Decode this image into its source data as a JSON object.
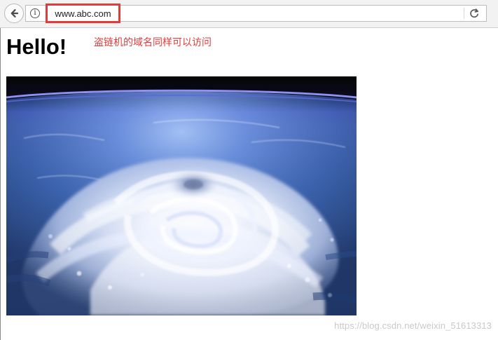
{
  "browser": {
    "url": "www.abc.com",
    "url_highlight_color": "#e53a3a",
    "back_icon": "back-arrow-icon",
    "info_icon": "info-icon",
    "info_glyph": "i",
    "reload_icon": "reload-icon"
  },
  "page": {
    "heading": "Hello!",
    "annotation": "盗链机的域名同样可以访问",
    "image_description": "hurricane-satellite-photo"
  },
  "watermark": {
    "text": "https://blog.csdn.net/weixin_51613313"
  },
  "colors": {
    "annotation": "#e53a3a",
    "watermark": "#c9c9c9",
    "toolbar": "#f2f2f2"
  }
}
